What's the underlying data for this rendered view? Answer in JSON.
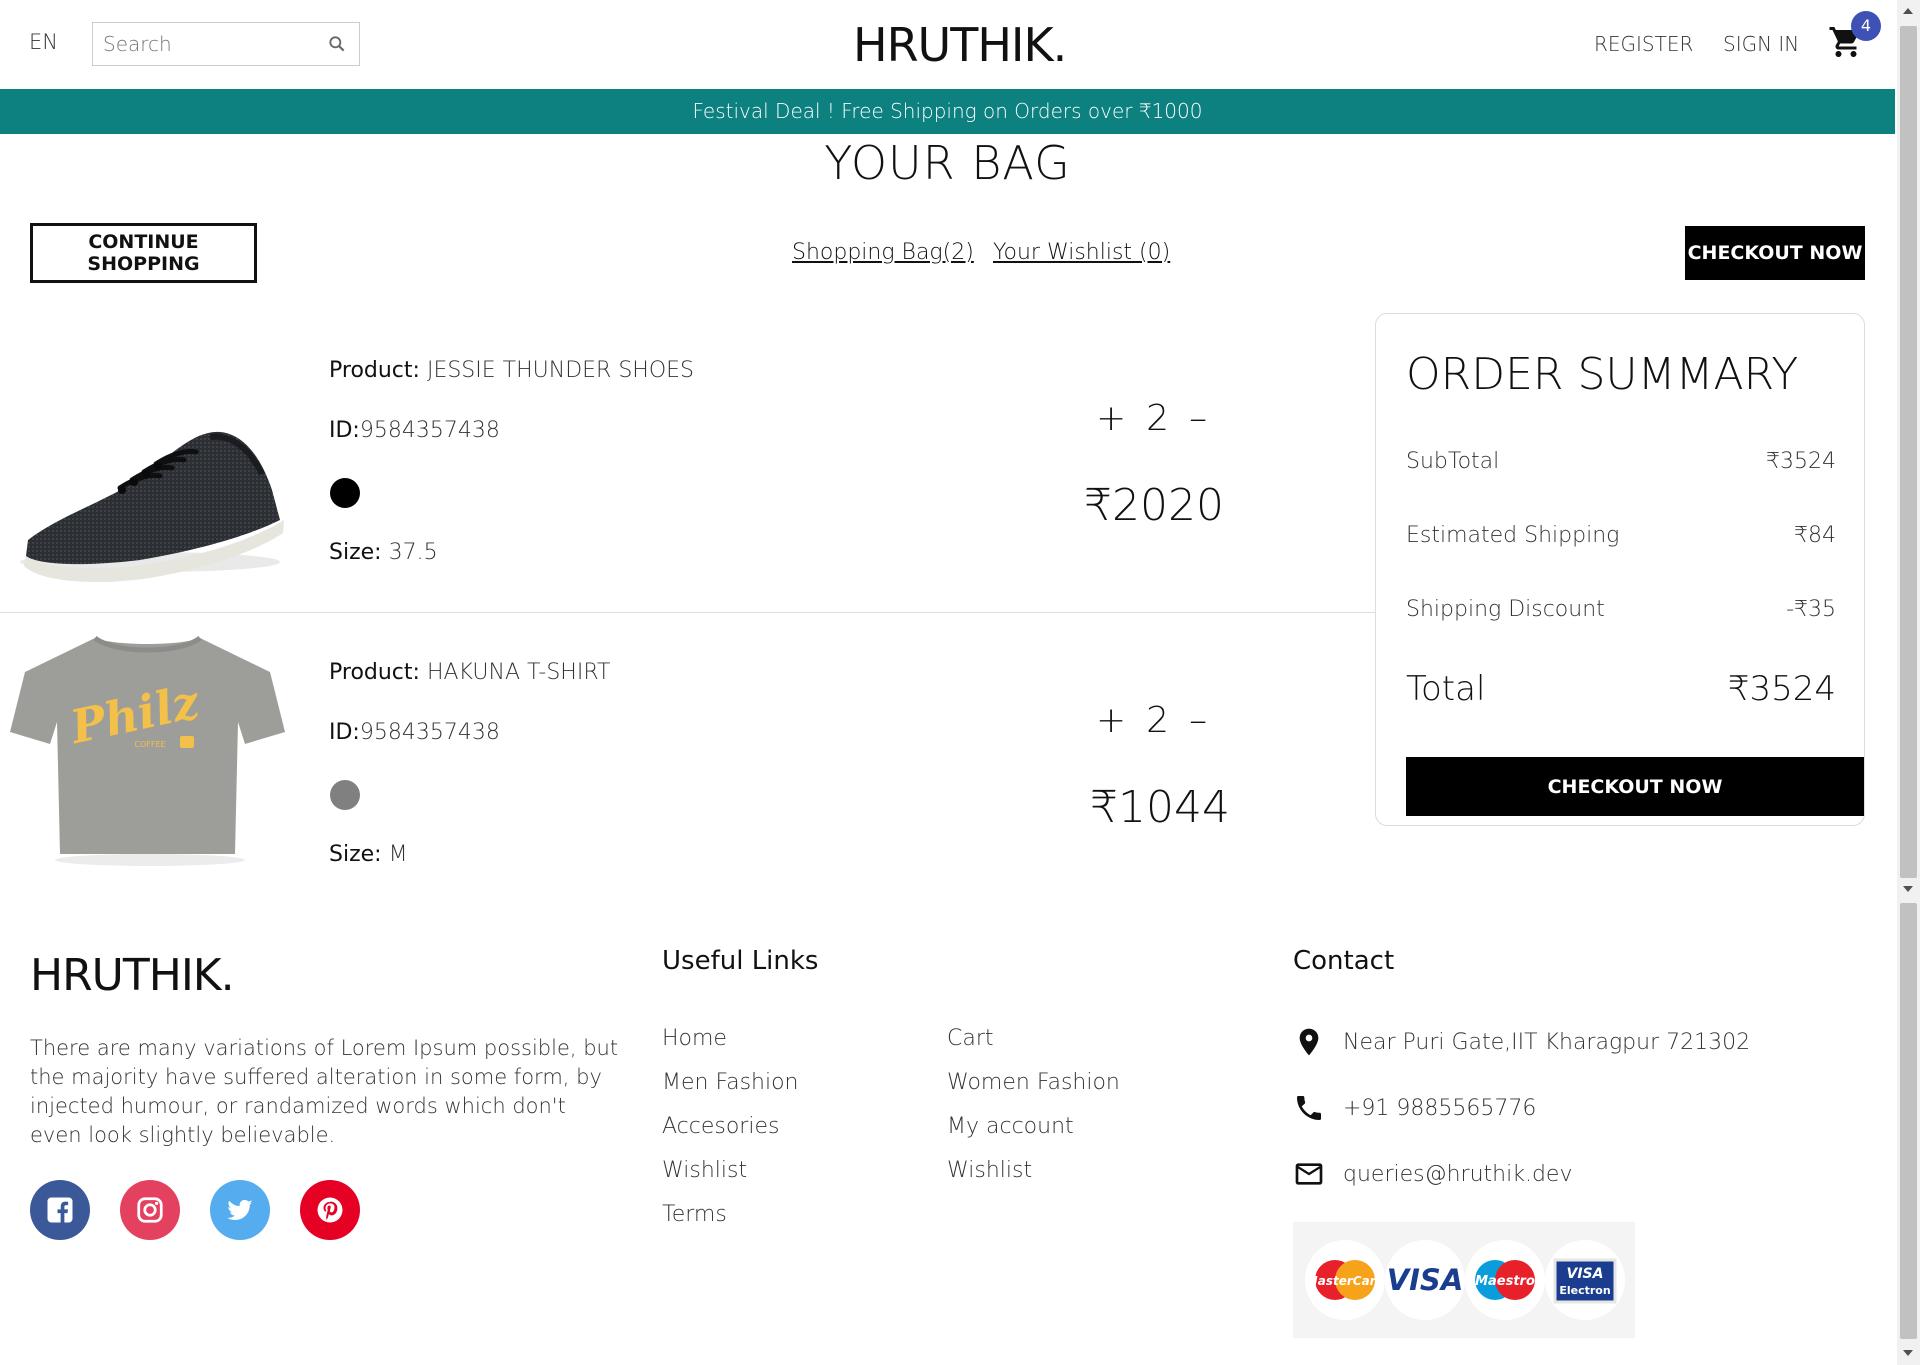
{
  "header": {
    "lang": "EN",
    "search_placeholder": "Search",
    "logo": "HRUTHIK.",
    "register": "REGISTER",
    "sign_in": "SIGN IN",
    "cart_count": "4"
  },
  "announcement": "Festival Deal ! Free Shipping on Orders over ₹1000",
  "bag": {
    "title": "YOUR BAG",
    "continue_label": "CONTINUE SHOPPING",
    "shopping_bag_link": "Shopping Bag(2)",
    "wishlist_link": "Your Wishlist (0)",
    "checkout_label": "CHECKOUT NOW"
  },
  "products": [
    {
      "product_label": "Product:",
      "name": "JESSIE THUNDER SHOES",
      "id_label": "ID:",
      "id": "9584357438",
      "color": "#000000",
      "size_label": "Size:",
      "size": "37.5",
      "plus": "+",
      "qty": "2",
      "minus": "–",
      "price": "₹2020"
    },
    {
      "product_label": "Product:",
      "name": "HAKUNA T-SHIRT",
      "id_label": "ID:",
      "id": "9584357438",
      "color": "#808080",
      "size_label": "Size:",
      "size": "M",
      "plus": "+",
      "qty": "2",
      "minus": "–",
      "price": "₹1044",
      "shirt_text": "Philz",
      "shirt_subtext": "COFFEE"
    }
  ],
  "summary": {
    "title": "ORDER SUMMARY",
    "subtotal_label": "SubTotal",
    "subtotal": "₹3524",
    "shipping_label": "Estimated Shipping",
    "shipping": "₹84",
    "discount_label": "Shipping Discount",
    "discount": "-₹35",
    "total_label": "Total",
    "total": "₹3524",
    "checkout_label": "CHECKOUT NOW"
  },
  "footer": {
    "logo": "HRUTHIK.",
    "description": "There are many variations of Lorem Ipsum possible, but the majority have suffered alteration in some form, by injected humour, or randamized words which don't even look slightly believable.",
    "useful_links_title": "Useful Links",
    "links_col1": [
      "Home",
      "Men Fashion",
      "Accesories",
      "Wishlist",
      "Terms"
    ],
    "links_col2": [
      "Cart",
      "Women Fashion",
      "My account",
      "Wishlist"
    ],
    "contact_title": "Contact",
    "address": "Near Puri Gate,IIT Kharagpur 721302",
    "phone": "+91 9885565776",
    "email": "queries@hruthik.dev",
    "payment": {
      "mastercard": "MasterCard",
      "visa": "VISA",
      "maestro": "Maestro",
      "visa_electron_top": "VISA",
      "visa_electron_bottom": "Electron"
    }
  },
  "colors": {
    "accent": "#0d8080",
    "badge": "#3f51b5",
    "facebook": "#3b5998",
    "instagram": "#e4405f",
    "twitter": "#55acee",
    "pinterest": "#e60023"
  }
}
